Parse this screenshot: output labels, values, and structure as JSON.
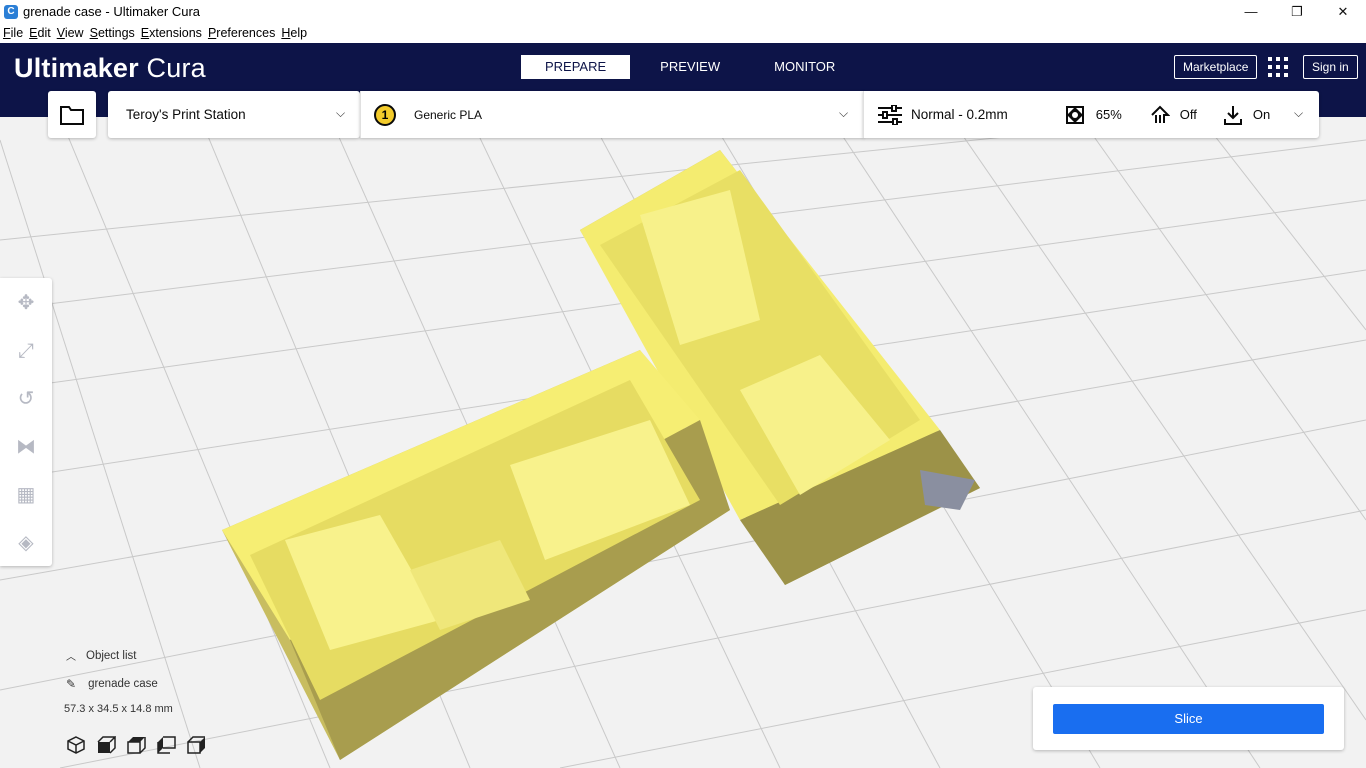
{
  "window": {
    "title": "grenade case - Ultimaker Cura",
    "app_icon": "cura-app-icon",
    "controls": [
      "—",
      "❐",
      "✕"
    ]
  },
  "menu": [
    "File",
    "Edit",
    "View",
    "Settings",
    "Extensions",
    "Preferences",
    "Help"
  ],
  "header": {
    "logo_bold": "Ultimaker",
    "logo_light": " Cura",
    "tabs": [
      {
        "label": "PREPARE",
        "active": true
      },
      {
        "label": "PREVIEW",
        "active": false
      },
      {
        "label": "MONITOR",
        "active": false
      }
    ],
    "marketplace": "Marketplace",
    "sign_in": "Sign in",
    "colors": {
      "header_bg": "#0d1448",
      "accent": "#196ef0",
      "model": "#f5ee6c"
    }
  },
  "toolbar": {
    "printer": "Teroy's Print Station",
    "extruder_number": "1",
    "material": "Generic PLA",
    "profile": "Normal - 0.2mm",
    "infill": "65%",
    "support": "Off",
    "adhesion": "On"
  },
  "sidebar_tools": [
    "move-icon",
    "scale-icon",
    "rotate-icon",
    "mirror-icon",
    "per-model-settings-icon",
    "support-blocker-icon"
  ],
  "object_list": {
    "toggle_label": "Object list",
    "item_name": "grenade case",
    "dimensions": "57.3 x 34.5 x 14.8 mm"
  },
  "view_cubes": [
    "3d-view-icon",
    "front-view-icon",
    "top-view-icon",
    "left-view-icon",
    "right-view-icon"
  ],
  "slice": {
    "label": "Slice"
  }
}
